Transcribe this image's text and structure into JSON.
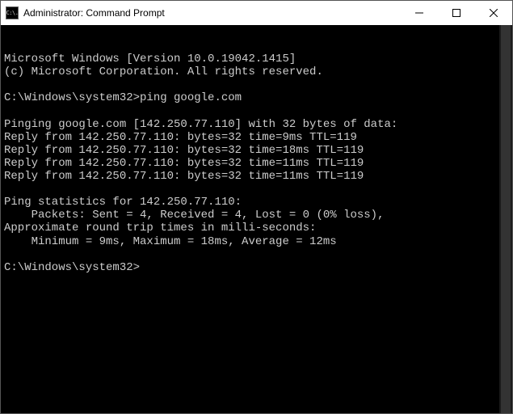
{
  "window": {
    "title": "Administrator: Command Prompt",
    "icon_text": "C:\\."
  },
  "terminal": {
    "lines": [
      "Microsoft Windows [Version 10.0.19042.1415]",
      "(c) Microsoft Corporation. All rights reserved.",
      "",
      "C:\\Windows\\system32>ping google.com",
      "",
      "Pinging google.com [142.250.77.110] with 32 bytes of data:",
      "Reply from 142.250.77.110: bytes=32 time=9ms TTL=119",
      "Reply from 142.250.77.110: bytes=32 time=18ms TTL=119",
      "Reply from 142.250.77.110: bytes=32 time=11ms TTL=119",
      "Reply from 142.250.77.110: bytes=32 time=11ms TTL=119",
      "",
      "Ping statistics for 142.250.77.110:",
      "    Packets: Sent = 4, Received = 4, Lost = 0 (0% loss),",
      "Approximate round trip times in milli-seconds:",
      "    Minimum = 9ms, Maximum = 18ms, Average = 12ms",
      "",
      "C:\\Windows\\system32>"
    ]
  }
}
